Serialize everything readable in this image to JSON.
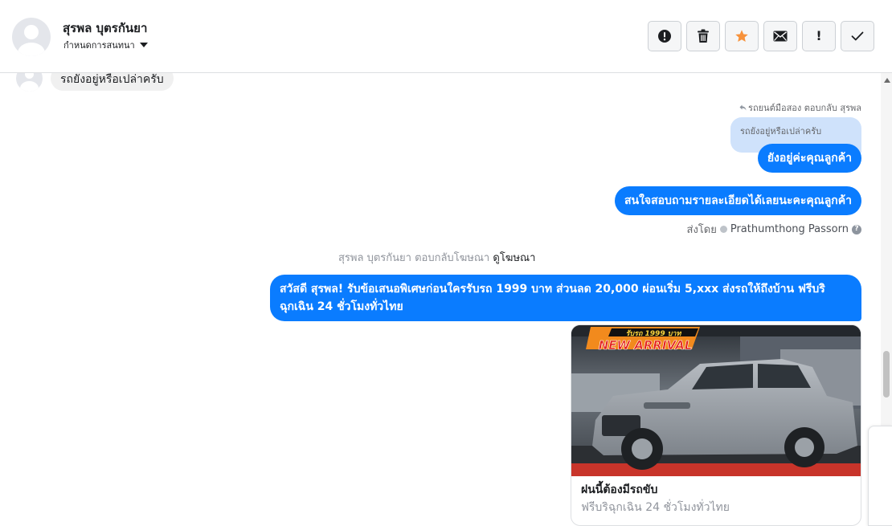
{
  "header": {
    "contact_name": "สุรพล บุตรกันยา",
    "assign_label": "กำหนดการสนทนา",
    "toolbar": [
      {
        "name": "spam-button",
        "icon": "alert-circle-icon"
      },
      {
        "name": "delete-button",
        "icon": "trash-icon"
      },
      {
        "name": "star-button",
        "icon": "star-icon"
      },
      {
        "name": "mark-unread-button",
        "icon": "envelope-icon"
      },
      {
        "name": "follow-up-button",
        "icon": "exclamation-icon",
        "glyph": "!"
      },
      {
        "name": "mark-done-button",
        "icon": "checkmark-icon"
      }
    ]
  },
  "colors": {
    "accent_blue": "#0a7cff",
    "quoted_bg": "#cfe2fb",
    "star_orange": "#f7923b"
  },
  "messages": {
    "incoming_partial": "รถยังอยู่หรือเปล่าครับ",
    "reply_meta": "รถยนต์มือสอง ตอบกลับ สุรพล",
    "quoted_text": "รถยังอยู่หรือเปล่าครับ",
    "reply_1": "ยังอยู่ค่ะคุณลูกค้า",
    "reply_2": "สนใจสอบถามรายละเอียดได้เลยนะคะคุณลูกค้า",
    "sent_by_label": "ส่งโดย",
    "sent_by_name": "Prathumthong Passorn",
    "ad_meta_text": "สุรพล บุตรกันยา ตอบกลับโฆษณา",
    "ad_meta_link": "ดูโฆษณา",
    "ad_message": "สวัสดี สุรพล! รับข้อเสนอพิเศษก่อนใครรับรถ 1999 บาท ส่วนลด 20,000 ผ่อนเริ่ม 5,xxx ส่งรถให้ถึงบ้าน ฟรีบริการฉุกเฉิน 24 ชั่วโมงทั่วไทย",
    "ad_message_display": "สวัสดี สุรพล! รับข้อเสนอพิเศษก่อนใครรับรถ 1999 บาท ส่วนลด 20,000 ผ่อนเริ่ม 5,xxx ส่งรถให้ถึงบ้าน ฟรีบริ\nฉุกเฉิน 24 ชั่วโมงทั่วไทย"
  },
  "card": {
    "banner_top": "รับรถ 1999 บาท",
    "banner_main": "NEW ARRIVAL",
    "title": "ฝนนี้ต้องมีรถขับ",
    "subtitle": "ฟรีบริฉุกเฉิน 24 ชั่วโมงทั่วไทย"
  }
}
